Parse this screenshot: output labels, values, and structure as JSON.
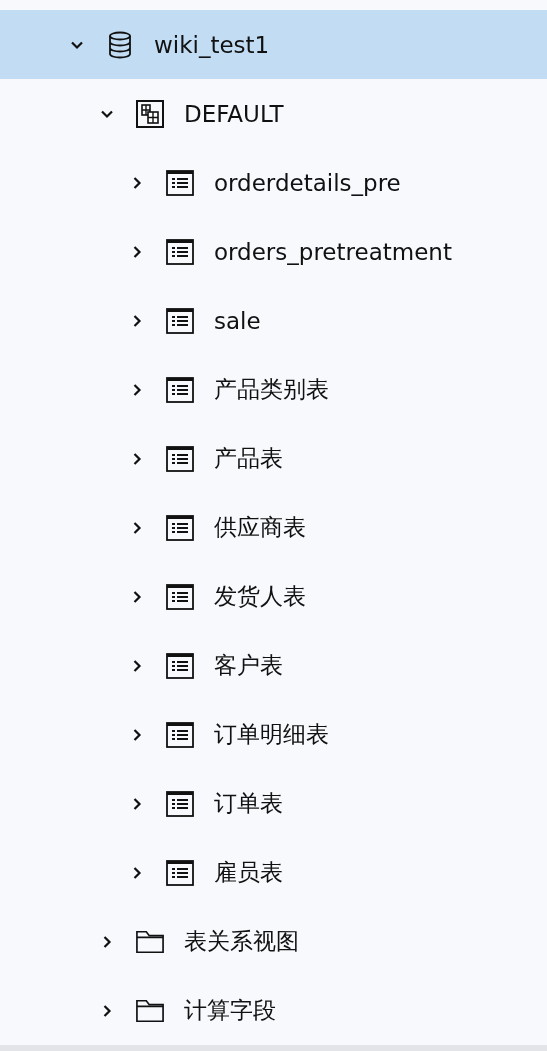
{
  "tree": [
    {
      "kind": "database",
      "label": "wiki_test1",
      "expanded": true,
      "selected": true,
      "children": [
        {
          "kind": "schema",
          "label": "DEFAULT",
          "expanded": true,
          "selected": false,
          "children": [
            {
              "kind": "table",
              "label": "orderdetails_pre",
              "expanded": false,
              "selected": false
            },
            {
              "kind": "table",
              "label": "orders_pretreatment",
              "expanded": false,
              "selected": false
            },
            {
              "kind": "table",
              "label": "sale",
              "expanded": false,
              "selected": false
            },
            {
              "kind": "table",
              "label": "产品类别表",
              "expanded": false,
              "selected": false
            },
            {
              "kind": "table",
              "label": "产品表",
              "expanded": false,
              "selected": false
            },
            {
              "kind": "table",
              "label": "供应商表",
              "expanded": false,
              "selected": false
            },
            {
              "kind": "table",
              "label": "发货人表",
              "expanded": false,
              "selected": false
            },
            {
              "kind": "table",
              "label": "客户表",
              "expanded": false,
              "selected": false
            },
            {
              "kind": "table",
              "label": "订单明细表",
              "expanded": false,
              "selected": false
            },
            {
              "kind": "table",
              "label": "订单表",
              "expanded": false,
              "selected": false
            },
            {
              "kind": "table",
              "label": "雇员表",
              "expanded": false,
              "selected": false
            }
          ]
        },
        {
          "kind": "folder",
          "label": "表关系视图",
          "expanded": false,
          "selected": false
        },
        {
          "kind": "folder",
          "label": "计算字段",
          "expanded": false,
          "selected": false
        }
      ]
    }
  ]
}
